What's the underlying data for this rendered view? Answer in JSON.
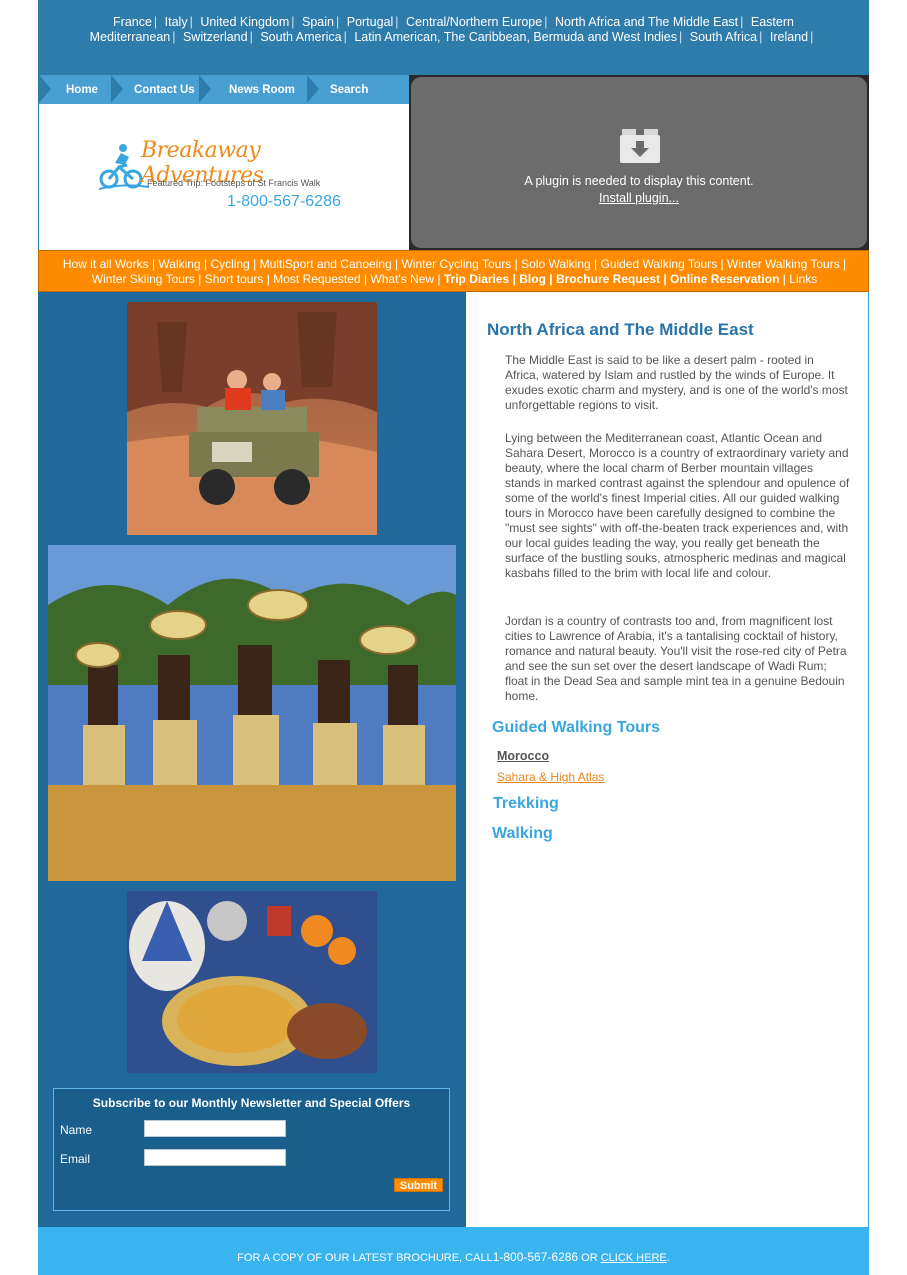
{
  "topbar": {
    "destinations": [
      "France",
      "Italy",
      "United Kingdom",
      "Spain",
      "Portugal",
      "Central/Northern Europe",
      "North Africa and The Middle East",
      "Eastern Mediterranean",
      "Switzerland",
      "South America",
      "Latin American, The Caribbean, Bermuda and West Indies",
      "South Africa",
      "Ireland"
    ]
  },
  "nav": {
    "home": "Home",
    "contact": "Contact Us",
    "news": "News Room",
    "search": "Search"
  },
  "logo": {
    "title": "Breakaway Adventures",
    "featured": "Featured Trip: Footsteps of St Francis Walk",
    "phone": "1-800-567-6286"
  },
  "plugin": {
    "message": "A plugin is needed to display this content.",
    "install": "Install plugin..."
  },
  "menu": {
    "items": [
      {
        "label": "How it all Works",
        "bold": false
      },
      {
        "label": "Walking",
        "bold": false
      },
      {
        "label": "Cycling",
        "bold": false
      },
      {
        "label": "MultiSport and Canoeing",
        "bold": false
      },
      {
        "label": "Winter Cycling Tours",
        "bold": false
      },
      {
        "label": "Solo Walking",
        "bold": false
      },
      {
        "label": "Guided Walking Tours",
        "bold": false
      },
      {
        "label": "Winter Walking Tours",
        "bold": false
      },
      {
        "label": "Winter Skiing Tours",
        "bold": false
      },
      {
        "label": "Short tours",
        "bold": false
      },
      {
        "label": "Most Requested",
        "bold": false
      },
      {
        "label": "What's New",
        "bold": false
      },
      {
        "label": "Trip Diaries",
        "bold": true
      },
      {
        "label": "Blog",
        "bold": true
      },
      {
        "label": "Brochure Request",
        "bold": true
      },
      {
        "label": "Online Reservation",
        "bold": true
      },
      {
        "label": "Links",
        "bold": false
      }
    ]
  },
  "newsletter": {
    "title": "Subscribe to our Monthly Newsletter and Special Offers",
    "name_label": "Name",
    "email_label": "Email",
    "name_value": "",
    "email_value": "",
    "submit": "Submit"
  },
  "content": {
    "heading": "North Africa and The Middle East",
    "para1": "The Middle East is said to be like a desert palm - rooted in Africa, watered by Islam and rustled by the winds of Europe. It exudes exotic charm and mystery, and is one of the world's most unforgettable regions to visit.",
    "para2": "Lying between the Mediterranean coast, Atlantic Ocean and Sahara Desert, Morocco is a country of extraordinary variety and beauty, where the local charm of Berber mountain villages stands in marked contrast against the splendour and opulence of some of the world's finest Imperial cities. All our guided walking tours in Morocco have been carefully designed to combine the \"must see sights\" with off-the-beaten track experiences and, with our local guides leading the way, you really get beneath the surface of the bustling souks, atmospheric medinas and magical kasbahs filled to the brim with local life and colour.",
    "para3": "Jordan is a country of contrasts too and, from magnificent lost cities to Lawrence of Arabia, it's a tantalising cocktail of history, romance and natural beauty. You'll visit the rose-red city of Petra and see the sun set over the desert landscape of Wadi Rum; float in the Dead Sea and sample mint tea in a genuine Bedouin home.",
    "guided": "Guided Walking Tours",
    "morocco": "Morocco",
    "sahara": "Sahara & High Atlas",
    "trekking": "Trekking",
    "walking": "Walking"
  },
  "footer": {
    "prefix": "FOR A COPY OF OUR LATEST BROCHURE, CALL",
    "phone": "1-800-567-6286",
    "middle": " OR ",
    "link": "CLICK HERE",
    "suffix": "."
  },
  "colors": {
    "topbar": "#2e7cab",
    "orange_menu": "#ff8c00",
    "left_column": "#1f6a9b",
    "footer": "#3ab4ef",
    "heading": "#2a74a8",
    "subheading": "#3aa6e0"
  }
}
